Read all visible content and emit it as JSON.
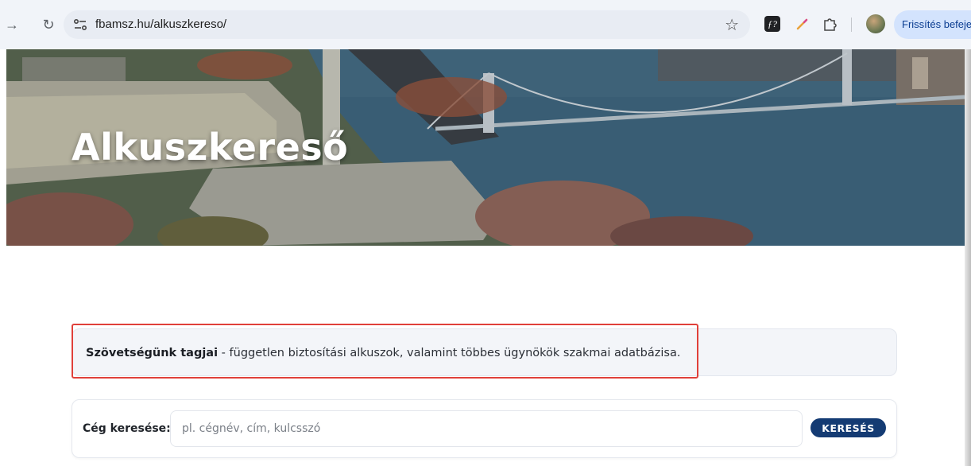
{
  "browser": {
    "url": "fbamsz.hu/alkuszkereso/",
    "update_button_label": "Frissítés befejez",
    "extension_label": "ƒ?"
  },
  "hero": {
    "title": "Alkuszkereső"
  },
  "info": {
    "bold_text": "Szövetségünk tagjai",
    "rest_text": " - független biztosítási alkuszok, valamint többes ügynökök szakmai adatbázisa."
  },
  "search": {
    "label": "Cég keresése:",
    "placeholder": "pl. cégnév, cím, kulcsszó",
    "value": "",
    "button_label": "KERESÉS"
  },
  "colors": {
    "accent": "#143b73",
    "highlight": "#e0403a"
  }
}
